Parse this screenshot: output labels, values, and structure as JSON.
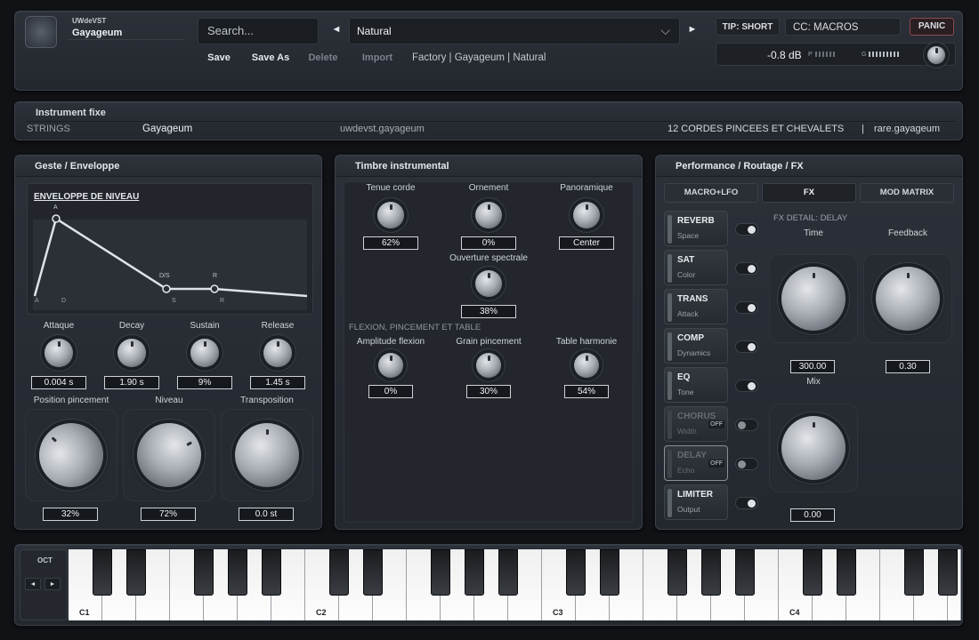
{
  "header": {
    "brand": "UWdeVST",
    "instrument": "Gayageum",
    "search_placeholder": "Search...",
    "preset": "Natural",
    "save": "Save",
    "save_as": "Save As",
    "delete": "Delete",
    "import": "Import",
    "breadcrumb": "Factory | Gayageum | Natural",
    "tip": "TIP: SHORT",
    "cc": "CC: MACROS",
    "panic": "PANIC",
    "db": "-0.8 dB",
    "p": "P",
    "g": "G"
  },
  "info": {
    "title": "Instrument fixe",
    "category": "STRINGS",
    "name": "Gayageum",
    "id": "uwdevst.gayageum",
    "description": "12 CORDES PINCEES ET CHEVALETS",
    "sep": "|",
    "rare": "rare.gayageum"
  },
  "geste": {
    "title": "Geste / Enveloppe",
    "env_title": "ENVELOPPE DE NIVEAU",
    "env_a": "A",
    "env_ds": "D/S",
    "env_r": "R",
    "axis_a": "A",
    "axis_d": "D",
    "axis_s": "S",
    "axis_r": "R",
    "knobs": [
      {
        "label": "Attaque",
        "value": "0.004 s"
      },
      {
        "label": "Decay",
        "value": "1.90 s"
      },
      {
        "label": "Sustain",
        "value": "9%"
      },
      {
        "label": "Release",
        "value": "1.45 s"
      }
    ],
    "big": [
      {
        "label": "Position pincement",
        "value": "32%",
        "level": 0.32
      },
      {
        "label": "Niveau",
        "value": "72%",
        "level": 0.72
      },
      {
        "label": "Transposition",
        "value": "0.0 st",
        "level": 0.5
      }
    ]
  },
  "timbre": {
    "title": "Timbre instrumental",
    "knobs": [
      {
        "label": "Tenue corde",
        "value": "62%"
      },
      {
        "label": "Ornement",
        "value": "0%"
      },
      {
        "label": "Panoramique",
        "value": "Center"
      }
    ],
    "spectral": {
      "label": "Ouverture spectrale",
      "value": "38%"
    },
    "section": "FLEXION, PINCEMENT ET TABLE",
    "knobs2": [
      {
        "label": "Amplitude flexion",
        "value": "0%"
      },
      {
        "label": "Grain pincement",
        "value": "30%"
      },
      {
        "label": "Table harmonie",
        "value": "54%"
      }
    ]
  },
  "perf": {
    "title": "Performance / Routage / FX",
    "tabs": [
      "MACRO+LFO",
      "FX",
      "MOD MATRIX"
    ],
    "fx_detail": "FX DETAIL: DELAY",
    "fx": [
      {
        "name": "REVERB",
        "sub": "Space",
        "on": true
      },
      {
        "name": "SAT",
        "sub": "Color",
        "on": true
      },
      {
        "name": "TRANS",
        "sub": "Attack",
        "on": true
      },
      {
        "name": "COMP",
        "sub": "Dynamics",
        "on": true
      },
      {
        "name": "EQ",
        "sub": "Tone",
        "on": true
      },
      {
        "name": "CHORUS",
        "sub": "Width",
        "on": false
      },
      {
        "name": "DELAY",
        "sub": "Echo",
        "on": false
      },
      {
        "name": "LIMITER",
        "sub": "Output",
        "on": true
      }
    ],
    "off": "OFF",
    "time_label": "Time",
    "time_value": "300.00",
    "feedback_label": "Feedback",
    "feedback_value": "0.30",
    "mix_label": "Mix",
    "mix_value": "0.00"
  },
  "keyboard": {
    "oct": "OCT",
    "left": "◄",
    "right": "►",
    "notes": [
      "C1",
      "C2",
      "C3",
      "C4"
    ]
  }
}
